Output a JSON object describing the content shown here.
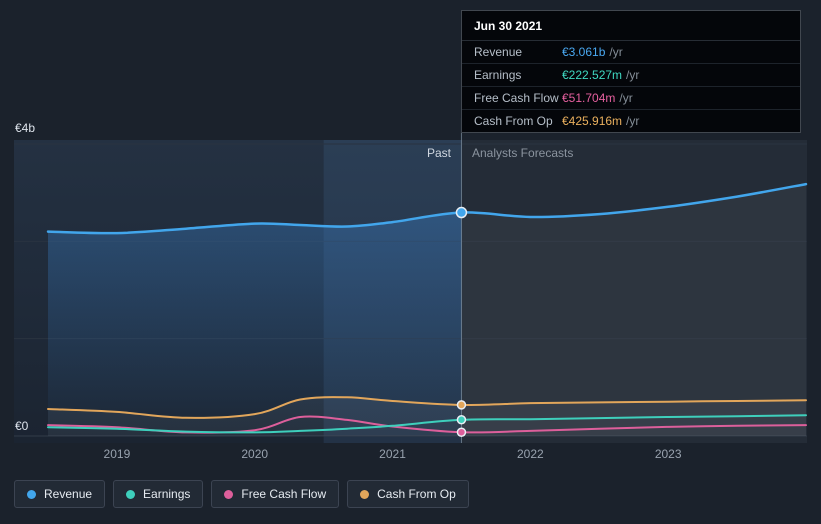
{
  "tooltip": {
    "title": "Jun 30 2021",
    "rows": [
      {
        "label": "Revenue",
        "value": "€3.061b",
        "suffix": "/yr",
        "color": "#4aa9f2"
      },
      {
        "label": "Earnings",
        "value": "€222.527m",
        "suffix": "/yr",
        "color": "#3fd9c2"
      },
      {
        "label": "Free Cash Flow",
        "value": "€51.704m",
        "suffix": "/yr",
        "color": "#e6609f"
      },
      {
        "label": "Cash From Op",
        "value": "€425.916m",
        "suffix": "/yr",
        "color": "#eab05e"
      }
    ]
  },
  "axis": {
    "y_top": "€4b",
    "y_zero": "€0",
    "x_ticks": [
      "2019",
      "2020",
      "2021",
      "2022",
      "2023"
    ]
  },
  "labels": {
    "past": "Past",
    "forecast": "Analysts Forecasts"
  },
  "legend": [
    {
      "label": "Revenue",
      "color": "#42a6ec"
    },
    {
      "label": "Earnings",
      "color": "#3ecfbc"
    },
    {
      "label": "Free Cash Flow",
      "color": "#dd5f9b"
    },
    {
      "label": "Cash From Op",
      "color": "#e2a65b"
    }
  ],
  "chart_data": {
    "type": "line",
    "x_unit": "year",
    "value_unit": "EUR billions",
    "x_range": [
      2018.5,
      2024.0
    ],
    "ylim": [
      0,
      4
    ],
    "marker_x": 2021.5,
    "marker_date": "Jun 30 2021",
    "highlight_range": [
      2020.5,
      2021.5
    ],
    "grid": "horizontal",
    "legend_position": "bottom",
    "x": [
      2018.5,
      2019,
      2019.5,
      2020,
      2020.33,
      2020.67,
      2021,
      2021.5,
      2022,
      2022.5,
      2023,
      2023.5,
      2024
    ],
    "series": [
      {
        "name": "Revenue",
        "color": "#42a6ec",
        "values": [
          2.8,
          2.78,
          2.84,
          2.91,
          2.89,
          2.87,
          2.93,
          3.061,
          3.0,
          3.04,
          3.14,
          3.28,
          3.45
        ]
      },
      {
        "name": "Earnings",
        "color": "#3ecfbc",
        "values": [
          0.12,
          0.1,
          0.06,
          0.05,
          0.07,
          0.1,
          0.14,
          0.2225,
          0.23,
          0.245,
          0.26,
          0.27,
          0.285
        ]
      },
      {
        "name": "Free Cash Flow",
        "color": "#dd5f9b",
        "values": [
          0.15,
          0.12,
          0.05,
          0.08,
          0.26,
          0.22,
          0.13,
          0.0517,
          0.07,
          0.1,
          0.125,
          0.14,
          0.15
        ]
      },
      {
        "name": "Cash From Op",
        "color": "#e2a65b",
        "values": [
          0.37,
          0.33,
          0.25,
          0.3,
          0.5,
          0.53,
          0.48,
          0.4259,
          0.45,
          0.46,
          0.47,
          0.48,
          0.49
        ]
      }
    ]
  }
}
